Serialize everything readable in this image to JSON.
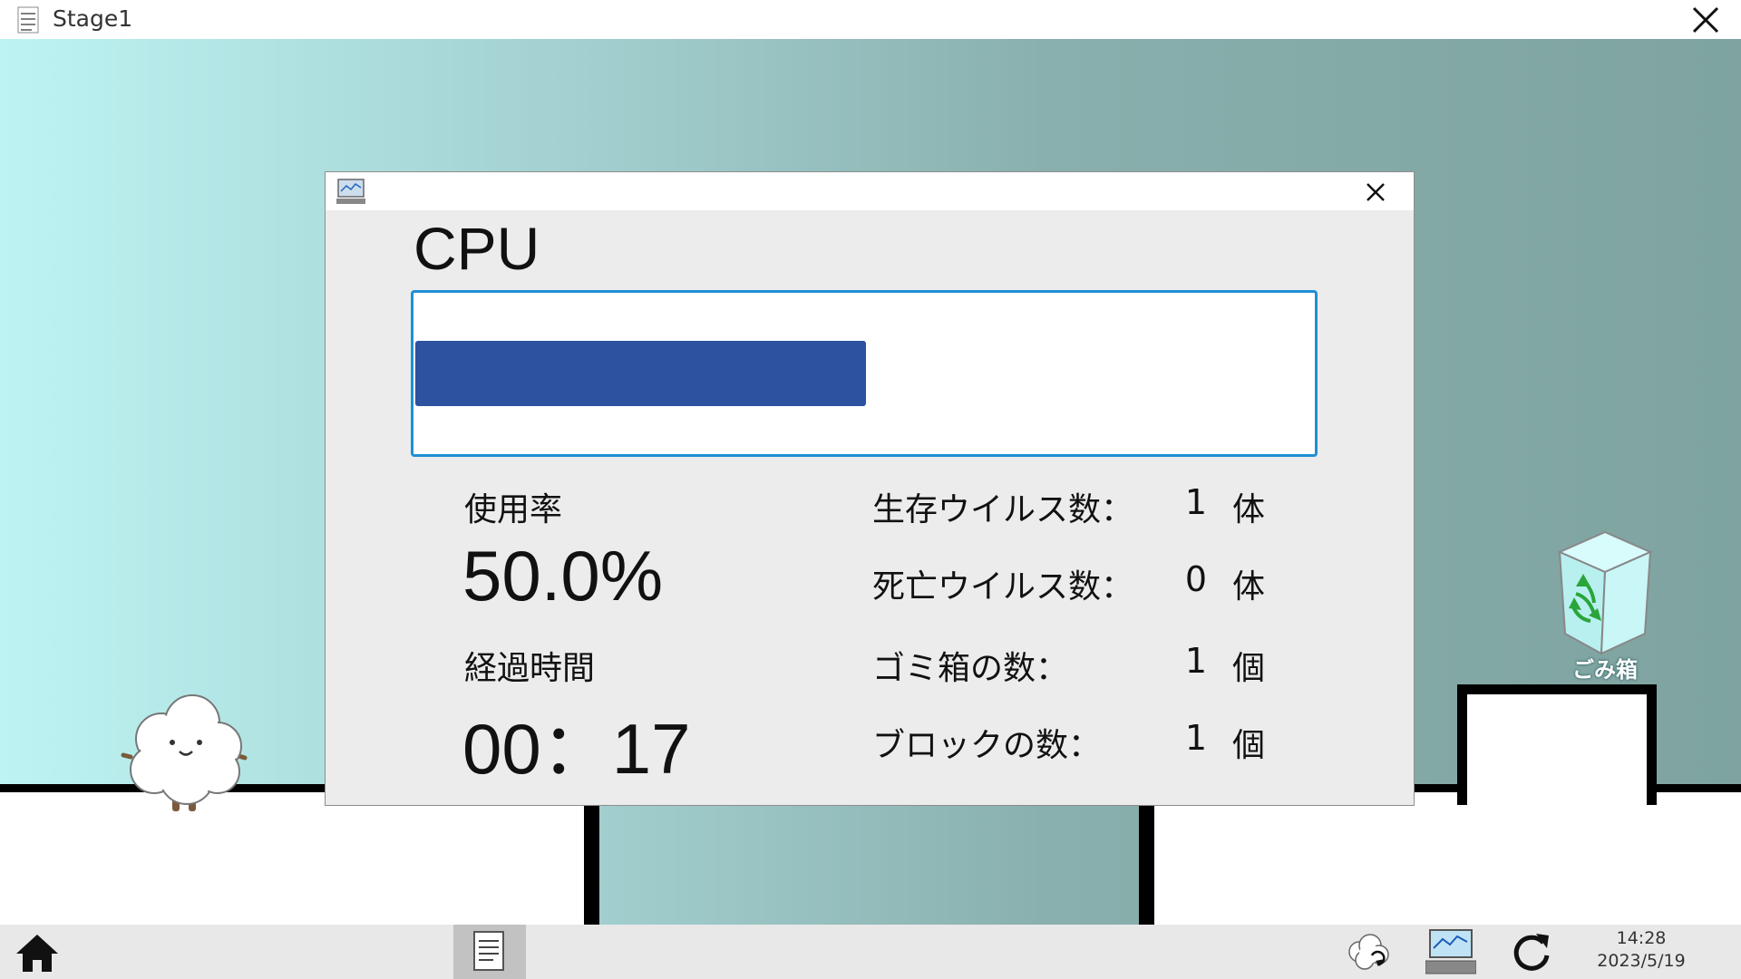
{
  "window": {
    "title": "Stage1",
    "menu_icon": "document-menu-icon",
    "close_icon": "close-icon"
  },
  "stage": {
    "trash_label": "ごみ箱",
    "trash_icon": "recycle-bin-icon",
    "character_icon": "cotton-cloud-character"
  },
  "dialog": {
    "icon": "monitor-icon",
    "title": "CPU",
    "usage_fraction": 0.5,
    "usage_label": "使用率",
    "usage_value": "50.0%",
    "elapsed_label": "経過時間",
    "elapsed_value": "00：17",
    "stats": [
      {
        "label": "生存ウイルス数：",
        "value": "1",
        "unit": "体"
      },
      {
        "label": "死亡ウイルス数：",
        "value": "0",
        "unit": "体"
      },
      {
        "label": "ゴミ箱の数：",
        "value": "1",
        "unit": "個"
      },
      {
        "label": "ブロックの数：",
        "value": "1",
        "unit": "個"
      }
    ],
    "colors": {
      "progress": "#2c52a0",
      "progress_border": "#1f8fd6"
    }
  },
  "taskbar": {
    "home_icon": "home-icon",
    "notes_icon": "notes-icon",
    "cloud_icon": "cloud-sync-icon",
    "monitor_icon": "monitor-icon",
    "reload_icon": "reload-icon",
    "time": "14:28",
    "date": "2023/5/19"
  }
}
